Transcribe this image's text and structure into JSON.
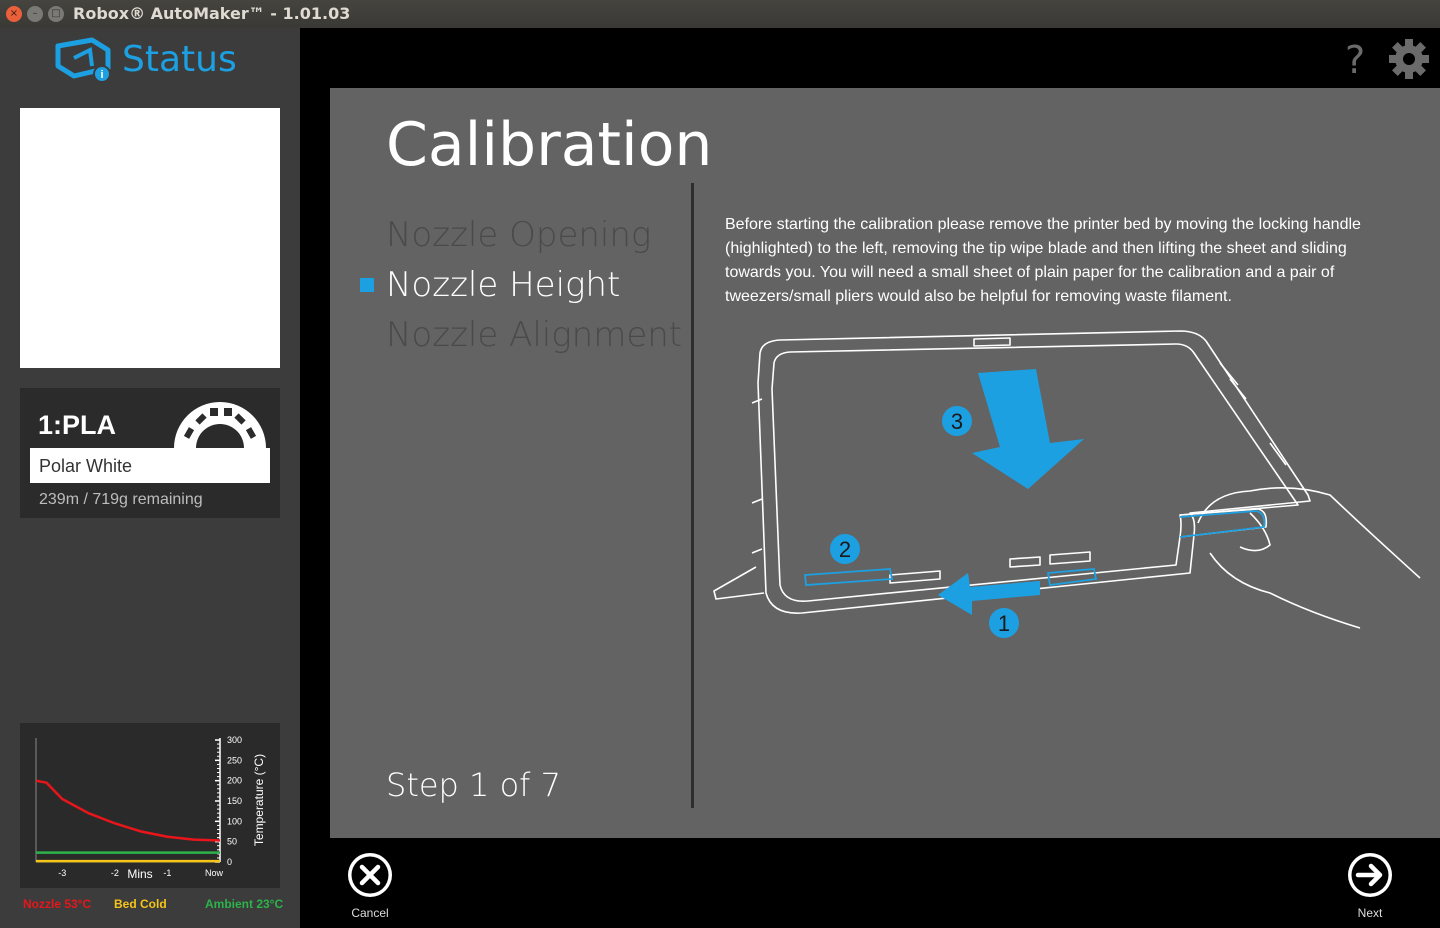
{
  "window": {
    "title": "Robox® AutoMaker™ - 1.01.03",
    "close_glyph": "×",
    "min_glyph": "–",
    "max_glyph": "□"
  },
  "sidebar": {
    "logo_text": "Status",
    "reel": {
      "id": "1:PLA",
      "material_name": "Polar White",
      "remaining": "239m / 719g remaining"
    },
    "graph": {
      "y_label": "Temperature (°C)",
      "y_ticks": [
        "300",
        "250",
        "200",
        "150",
        "100",
        "50",
        "0"
      ],
      "x_ticks": [
        "-3",
        "-2",
        "-1",
        "Now"
      ],
      "x_label": "Mins",
      "chart_data": {
        "type": "line",
        "ylabel": "Temperature (°C)",
        "xlabel": "Mins",
        "ylim": [
          0,
          300
        ],
        "series": [
          {
            "name": "Nozzle",
            "color": "#e8161b",
            "x": [
              -3.5,
              -3.3,
              -3,
              -2.5,
              -2,
              -1.5,
              -1,
              -0.5,
              0
            ],
            "y": [
              200,
              195,
              155,
              120,
              95,
              75,
              62,
              55,
              53
            ]
          },
          {
            "name": "Bed",
            "color": "#f5c518",
            "x": [
              -3.5,
              0
            ],
            "y": [
              2,
              2
            ]
          },
          {
            "name": "Ambient",
            "color": "#2cb34a",
            "x": [
              -3.5,
              0
            ],
            "y": [
              23,
              23
            ]
          }
        ]
      }
    },
    "legend": {
      "nozzle": "Nozzle 53°C",
      "bed": "Bed Cold",
      "ambient": "Ambient 23°C",
      "nozzle_color": "#e8161b",
      "bed_color": "#f5c518",
      "ambient_color": "#2cb34a"
    }
  },
  "header": {
    "help_icon": "?",
    "settings_icon": "gear-icon"
  },
  "calibration": {
    "title": "Calibration",
    "steps": [
      "Nozzle Opening",
      "Nozzle Height",
      "Nozzle Alignment"
    ],
    "active_step_index": 1,
    "step_counter": "Step 1 of 7",
    "instructions": "Before starting the calibration please remove the printer bed by moving the locking handle (highlighted) to the left, removing the tip wipe blade and then lifting the sheet and sliding towards you. You will need a small sheet of plain paper for the calibration and a pair of tweezers/small pliers would also be helpful for removing waste filament.",
    "illustration_labels": [
      "3",
      "2",
      "1"
    ]
  },
  "footer": {
    "cancel_label": "Cancel",
    "next_label": "Next"
  },
  "colors": {
    "accent": "#1da0e2",
    "panel": "#636363",
    "sidebar": "#3c3c3c"
  }
}
